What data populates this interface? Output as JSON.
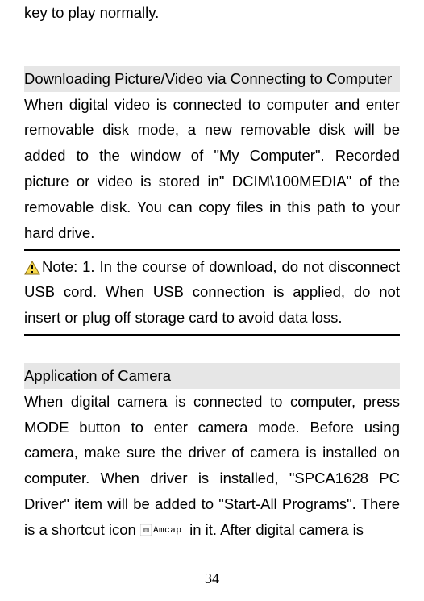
{
  "intro_line": "key to play normally.",
  "section1": {
    "heading": "Downloading Picture/Video via Connecting to Computer",
    "paragraph": "When digital video is connected to computer and enter removable disk mode, a new removable disk will be added to the window of \"My Computer\". Recorded picture or video is stored in\" DCIM\\100MEDIA\" of the removable disk. You can copy files in this path to your hard drive.",
    "note": "Note: 1. In the course of download, do not disconnect USB cord. When USB connection is applied, do not insert or plug off storage card to avoid data loss."
  },
  "section2": {
    "heading": "Application of Camera",
    "paragraph_part1": "When digital camera is connected to computer, press MODE button to enter camera mode. Before using camera, make sure the driver of camera is installed on computer. When driver is installed, \"SPCA1628 PC Driver\" item will be added to \"Start-All Programs\". There is a shortcut icon ",
    "paragraph_part2": " in it. After digital camera is"
  },
  "amcap_label": "Amcap",
  "page_number": "34"
}
